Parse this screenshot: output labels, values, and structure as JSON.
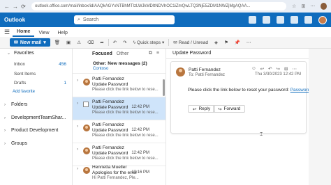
{
  "browser": {
    "url": "outlook.office.com/mail/inbox/id/AAQkAGYxNTBhMTIzLWJkMDItNDVhOC1iZmQwLTQ3NjE5ZDM1NWZjMgAQAA...",
    "nav_back": "←",
    "nav_forward": "→",
    "nav_reload": "⟳"
  },
  "suite": {
    "app_name": "Outlook",
    "search_placeholder": "Search"
  },
  "ribbon": {
    "tabs": [
      {
        "label": "Home"
      },
      {
        "label": "View"
      },
      {
        "label": "Help"
      }
    ]
  },
  "toolbar": {
    "new_mail": "New mail",
    "quick_steps": "Quick steps",
    "read_unread": "Read / Unread"
  },
  "folders": {
    "favorites": "Favorites",
    "inbox": "Inbox",
    "inbox_count": "456",
    "sent": "Sent Items",
    "drafts": "Drafts",
    "drafts_count": "1",
    "add_favorite": "Add favorite",
    "folders_label": "Folders",
    "group1": "DevelopmentTeamShar...",
    "group2": "Product Development",
    "groups": "Groups"
  },
  "list": {
    "focused": "Focused",
    "other": "Other",
    "other_banner_title": "Other: New messages (2)",
    "other_banner_sub": "Contoso",
    "messages": [
      {
        "sender": "Patti Fernandez",
        "subject": "Update Password",
        "time": "",
        "preview": "Please click the link below to rese..."
      },
      {
        "sender": "Patti Fernandez",
        "subject": "Update Password",
        "time": "12:42 PM",
        "preview": "Please click the link below to rese..."
      },
      {
        "sender": "Patti Fernandez",
        "subject": "Update Password",
        "time": "12:42 PM",
        "preview": "Please click the link below to rese..."
      },
      {
        "sender": "Patti Fernandez",
        "subject": "Update Password",
        "time": "12:42 PM",
        "preview": "Please click the link below to rese..."
      },
      {
        "sender": "Henrietta Mueller",
        "subject": "Apologies for the error",
        "time": "12:16 PM",
        "preview": "Hi Patti Fernandez, Ple..."
      }
    ]
  },
  "reading": {
    "subject": "Update Password",
    "from": "Patti Fernandez",
    "to": "To: Patti Fernandez",
    "time": "Thu 3/30/2023 12:42 PM",
    "body": "Please click the link below to reset your password:",
    "link": "Password Reset",
    "reply": "Reply",
    "forward": "Forward"
  }
}
